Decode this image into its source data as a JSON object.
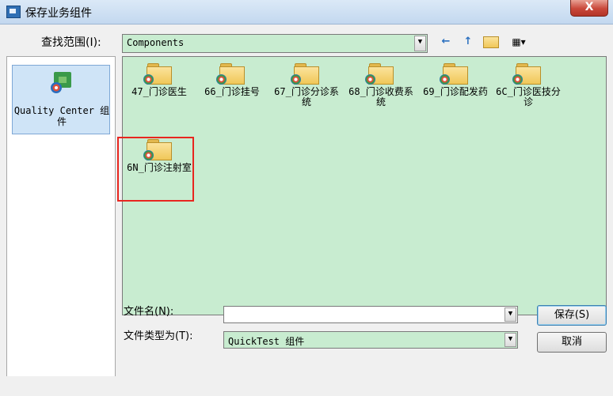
{
  "window": {
    "title": "保存业务组件",
    "close_label": "X"
  },
  "look_in": {
    "label": "查找范围(I):",
    "value": "Components"
  },
  "toolbar": {
    "back": "←",
    "up": "↑",
    "new_folder": "📁",
    "views": "▦▾"
  },
  "places": [
    {
      "label": "Quality Center 组件"
    }
  ],
  "folders": [
    {
      "label": "47_门诊医生"
    },
    {
      "label": "66_门诊挂号"
    },
    {
      "label": "67_门诊分诊系统"
    },
    {
      "label": "68_门诊收费系统"
    },
    {
      "label": "69_门诊配发药"
    },
    {
      "label": "6C_门诊医技分诊"
    },
    {
      "label": "6N_门诊注射室"
    }
  ],
  "file_name": {
    "label": "文件名(N):",
    "value": ""
  },
  "file_type": {
    "label": "文件类型为(T):",
    "value": "QuickTest 组件"
  },
  "buttons": {
    "save": "保存(S)",
    "cancel": "取消"
  },
  "colors": {
    "list_bg": "#c8ecd0",
    "highlight": "#e8261f"
  }
}
